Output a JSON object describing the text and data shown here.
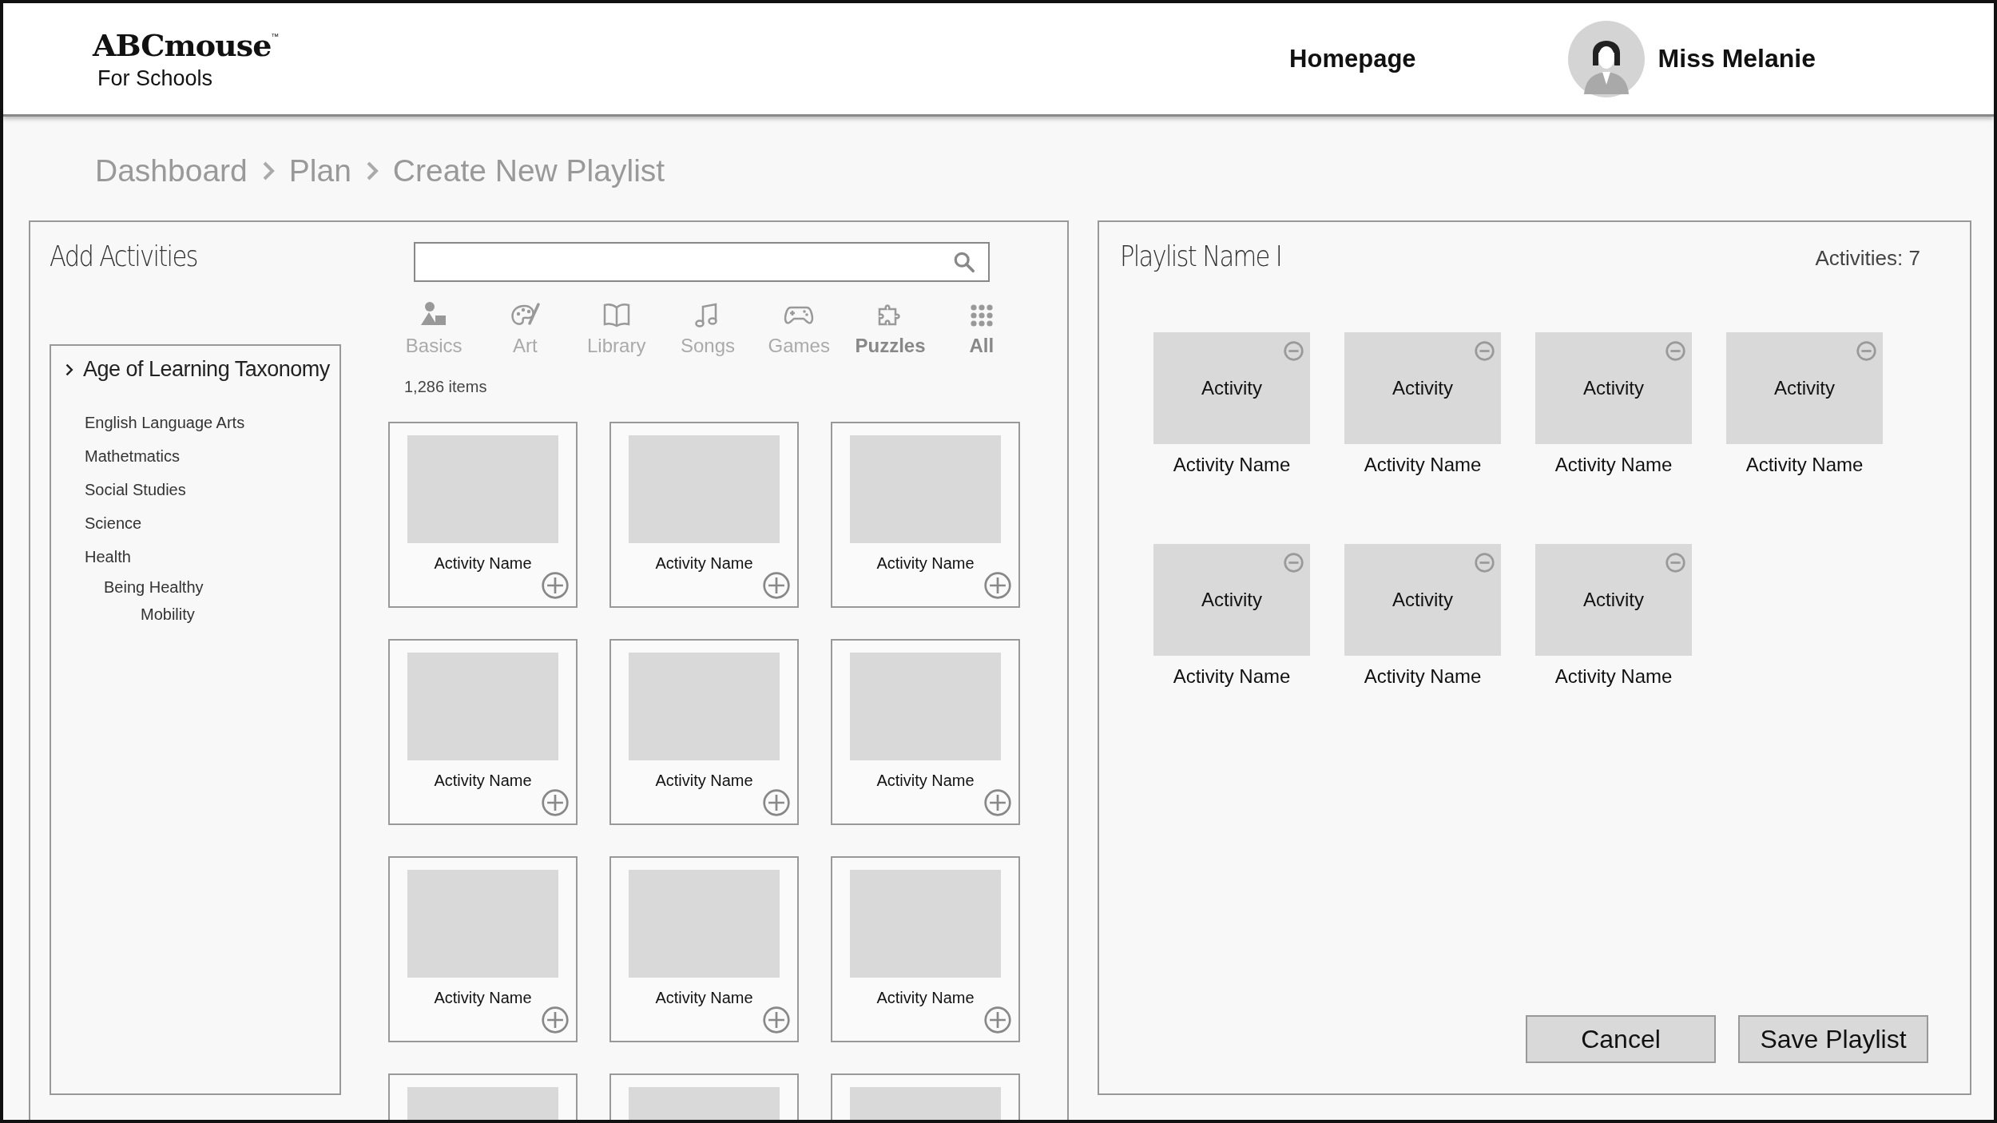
{
  "header": {
    "logo": "ABCmouse",
    "logo_mark": "™",
    "logo_subtitle": "For Schools",
    "nav_link": "Homepage",
    "user_name": "Miss Melanie"
  },
  "breadcrumb": [
    "Dashboard",
    "Plan",
    "Create New Playlist"
  ],
  "add_activities": {
    "title": "Add Activities",
    "taxonomy": {
      "label": "Age of Learning Taxonomy",
      "children": [
        {
          "label": "English Language Arts"
        },
        {
          "label": "Mathetmatics"
        },
        {
          "label": "Social Studies"
        },
        {
          "label": "Science"
        },
        {
          "label": "Health",
          "children": [
            {
              "label": "Being Healthy",
              "children": [
                {
                  "label": "Mobility"
                }
              ]
            }
          ]
        }
      ]
    },
    "categories": [
      {
        "label": "Basics",
        "kind": "shapes",
        "selected": false
      },
      {
        "label": "Art",
        "kind": "palette",
        "selected": false
      },
      {
        "label": "Library",
        "kind": "book",
        "selected": false
      },
      {
        "label": "Songs",
        "kind": "note",
        "selected": false
      },
      {
        "label": "Games",
        "kind": "gamepad",
        "selected": false
      },
      {
        "label": "Puzzles",
        "kind": "puzzle",
        "selected": true
      },
      {
        "label": "All",
        "kind": "grid",
        "selected": true
      }
    ],
    "item_count": "1,286 items",
    "cards": [
      {
        "kind": "full",
        "name": "Activity Name"
      },
      {
        "kind": "full",
        "name": "Activity Name"
      },
      {
        "kind": "full",
        "name": "Activity Name"
      },
      {
        "kind": "full",
        "name": "Activity Name"
      },
      {
        "kind": "full",
        "name": "Activity Name"
      },
      {
        "kind": "full",
        "name": "Activity Name"
      },
      {
        "kind": "full",
        "name": "Activity Name"
      },
      {
        "kind": "full",
        "name": "Activity Name"
      },
      {
        "kind": "full",
        "name": "Activity Name"
      },
      {
        "kind": "partial"
      },
      {
        "kind": "partial"
      },
      {
        "kind": "partial"
      }
    ]
  },
  "playlist": {
    "title": "Playlist Name I",
    "count": "Activities: 7",
    "items": [
      {
        "thumb": "Activity",
        "name": "Activity Name"
      },
      {
        "thumb": "Activity",
        "name": "Activity Name"
      },
      {
        "thumb": "Activity",
        "name": "Activity Name"
      },
      {
        "thumb": "Activity",
        "name": "Activity Name"
      },
      {
        "thumb": "Activity",
        "name": "Activity Name"
      },
      {
        "thumb": "Activity",
        "name": "Activity Name"
      },
      {
        "thumb": "Activity",
        "name": "Activity Name"
      }
    ],
    "buttons": [
      "Cancel",
      "Save Playlist"
    ]
  }
}
